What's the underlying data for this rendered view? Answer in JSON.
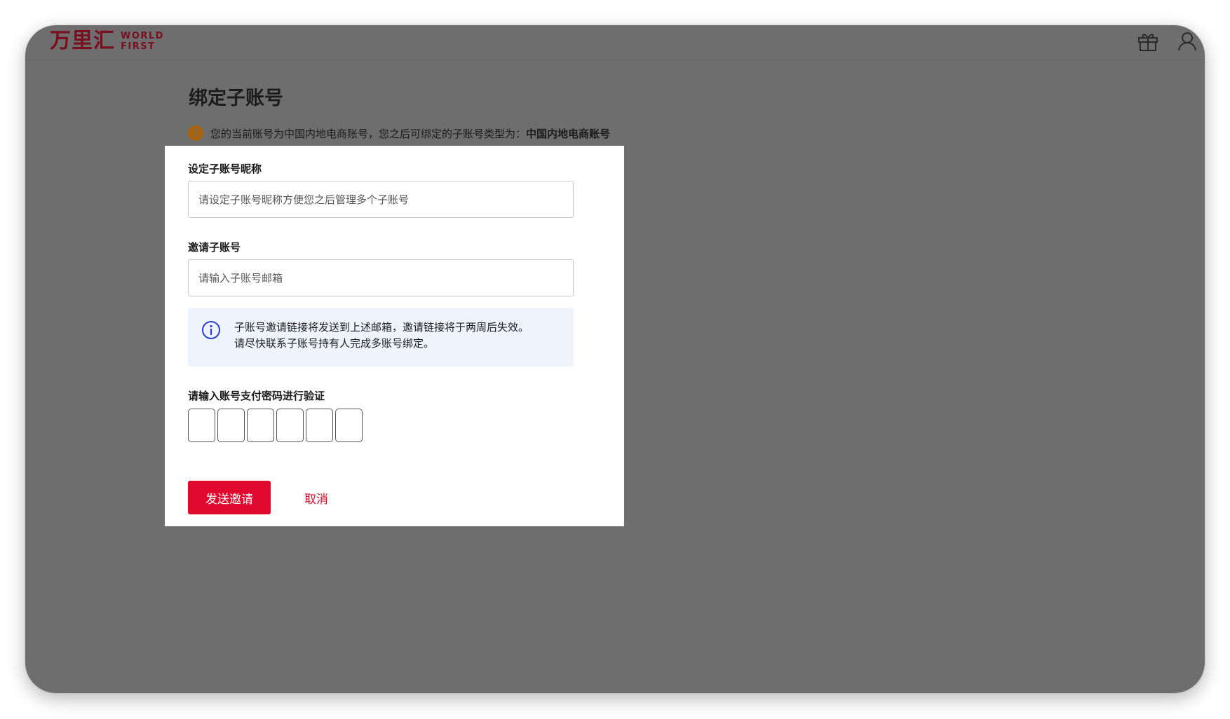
{
  "header": {
    "logo_cn": "万里汇",
    "logo_en_line1": "WORLD",
    "logo_en_line2": "FIRST",
    "icons": [
      "gift-icon",
      "user-icon"
    ]
  },
  "page": {
    "title": "绑定子账号",
    "notice_text": "您的当前账号为中国内地电商账号，您之后可绑定的子账号类型为：",
    "notice_strong": "中国内地电商账号"
  },
  "modal": {
    "nickname_label": "设定子账号昵称",
    "nickname_placeholder": "请设定子账号昵称方便您之后管理多个子账号",
    "nickname_value": "",
    "invite_label": "邀请子账号",
    "email_placeholder": "请输入子账号邮箱",
    "email_value": "",
    "info_line1": "子账号邀请链接将发送到上述邮箱，邀请链接将于两周后失效。",
    "info_line2": "请尽快联系子账号持有人完成多账号绑定。",
    "password_label": "请输入账号支付密码进行验证",
    "pin_count": 6,
    "send_button": "发送邀请",
    "cancel_button": "取消"
  },
  "colors": {
    "brand": "#e0082d",
    "overlay": "#6e6e6e",
    "warning": "#a9620e",
    "info_bg": "#eef3fd",
    "info_icon": "#2b3fd6"
  }
}
